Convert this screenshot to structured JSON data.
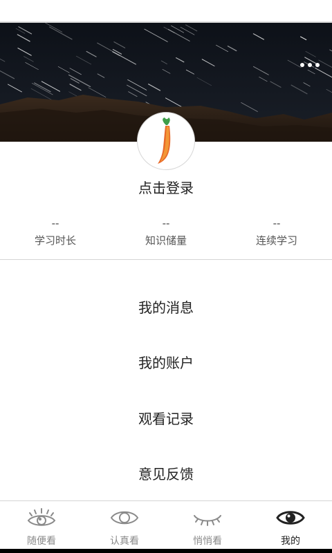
{
  "profile": {
    "login_label": "点击登录"
  },
  "stats": [
    {
      "value": "--",
      "label": "学习时长"
    },
    {
      "value": "--",
      "label": "知识储量"
    },
    {
      "value": "--",
      "label": "连续学习"
    }
  ],
  "menu": [
    {
      "label": "我的消息"
    },
    {
      "label": "我的账户"
    },
    {
      "label": "观看记录"
    },
    {
      "label": "意见反馈"
    }
  ],
  "tabs": [
    {
      "label": "随便看",
      "icon": "eye-lashes-icon"
    },
    {
      "label": "认真看",
      "icon": "eye-outline-icon"
    },
    {
      "label": "悄悄看",
      "icon": "eye-closed-icon"
    },
    {
      "label": "我的",
      "icon": "eye-filled-icon",
      "active": true
    }
  ],
  "colors": {
    "banner_sky": "#0f131b",
    "logo_orange": "#e86a2a",
    "logo_green": "#3f9e4a",
    "active_tab": "#222222",
    "inactive_tab": "#8a8a8a"
  }
}
